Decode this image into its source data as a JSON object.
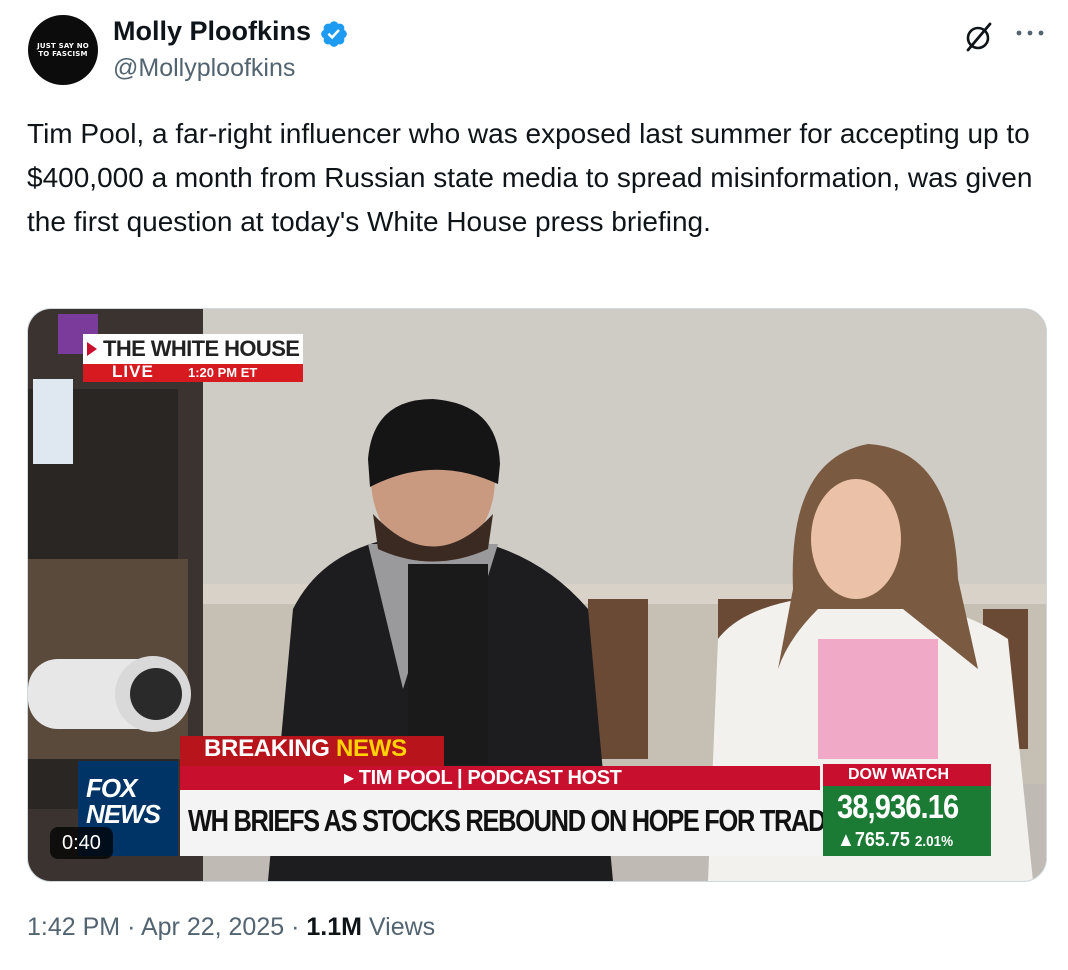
{
  "author": {
    "display_name": "Molly Ploofkins",
    "handle": "@Mollyploofkins",
    "avatar_text_line1": "JUST SAY NO",
    "avatar_text_line2": "TO FASCISM",
    "verified": true,
    "verified_color": "#1d9bf0"
  },
  "header_actions": {
    "grok_icon": "grok-slash-circle-icon",
    "more_icon": "more-horizontal-icon"
  },
  "tweet": {
    "text": "Tim Pool, a far-right influencer who was exposed last summer for accepting up to $400,000 a month from Russian state media to spread misinformation, was given the first question at today's White House press briefing."
  },
  "video": {
    "duration": "0:40",
    "overlay": {
      "location": "THE WHITE HOUSE",
      "live_label": "LIVE",
      "live_time": "1:20 PM ET",
      "breaking": "BREAKING",
      "breaking_news": "NEWS",
      "subtitle": "▸ TIM POOL | PODCAST HOST",
      "headline": "WH BRIEFS AS STOCKS REBOUND ON HOPE FOR TRADE DEAL",
      "network_line1": "FOX",
      "network_line2": "NEWS",
      "dow_label": "DOW WATCH",
      "dow_value": "38,936.16",
      "dow_change": "▲765.75",
      "dow_pct": "2.01%"
    }
  },
  "footer": {
    "time": "1:42 PM",
    "separator": "·",
    "date": "Apr 22, 2025",
    "views_count": "1.1M",
    "views_label": "Views"
  },
  "colors": {
    "text_primary": "#0f1419",
    "text_secondary": "#536471",
    "fox_red": "#c8102e",
    "fox_blue": "#003366",
    "dow_green": "#1b7a33"
  }
}
